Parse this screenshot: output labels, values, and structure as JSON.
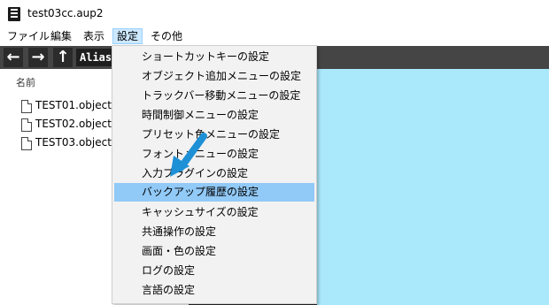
{
  "window": {
    "title": "test03cc.aup2"
  },
  "menubar": {
    "items": [
      {
        "label": "ファイル"
      },
      {
        "label": "編集"
      },
      {
        "label": "表示"
      },
      {
        "label": "設定"
      },
      {
        "label": "その他"
      }
    ],
    "active_index": 3
  },
  "toolbar": {
    "back_icon": "←",
    "forward_icon": "→",
    "up_icon": "↑",
    "alias_text": "Alias"
  },
  "file_pane": {
    "column_header": "名前",
    "files": [
      {
        "name": "TEST01.object"
      },
      {
        "name": "TEST02.object"
      },
      {
        "name": "TEST03.object"
      }
    ]
  },
  "settings_menu": {
    "items": [
      {
        "label": "ショートカットキーの設定"
      },
      {
        "label": "オブジェクト追加メニューの設定"
      },
      {
        "label": "トラックバー移動メニューの設定"
      },
      {
        "label": "時間制御メニューの設定"
      },
      {
        "label": "プリセット色メニューの設定"
      },
      {
        "label": "フォントメニューの設定"
      },
      {
        "label": "入力プラグインの設定"
      },
      {
        "label": "バックアップ履歴の設定"
      },
      {
        "label": "キャッシュサイズの設定"
      },
      {
        "label": "共通操作の設定"
      },
      {
        "label": "画面・色の設定"
      },
      {
        "label": "ログの設定"
      },
      {
        "label": "言語の設定"
      }
    ],
    "highlighted_index": 7
  },
  "colors": {
    "highlight": "#91c9f7",
    "preview_background": "#aae8fc",
    "toolbar": "#454545",
    "annotation_arrow": "#1e90d6"
  }
}
